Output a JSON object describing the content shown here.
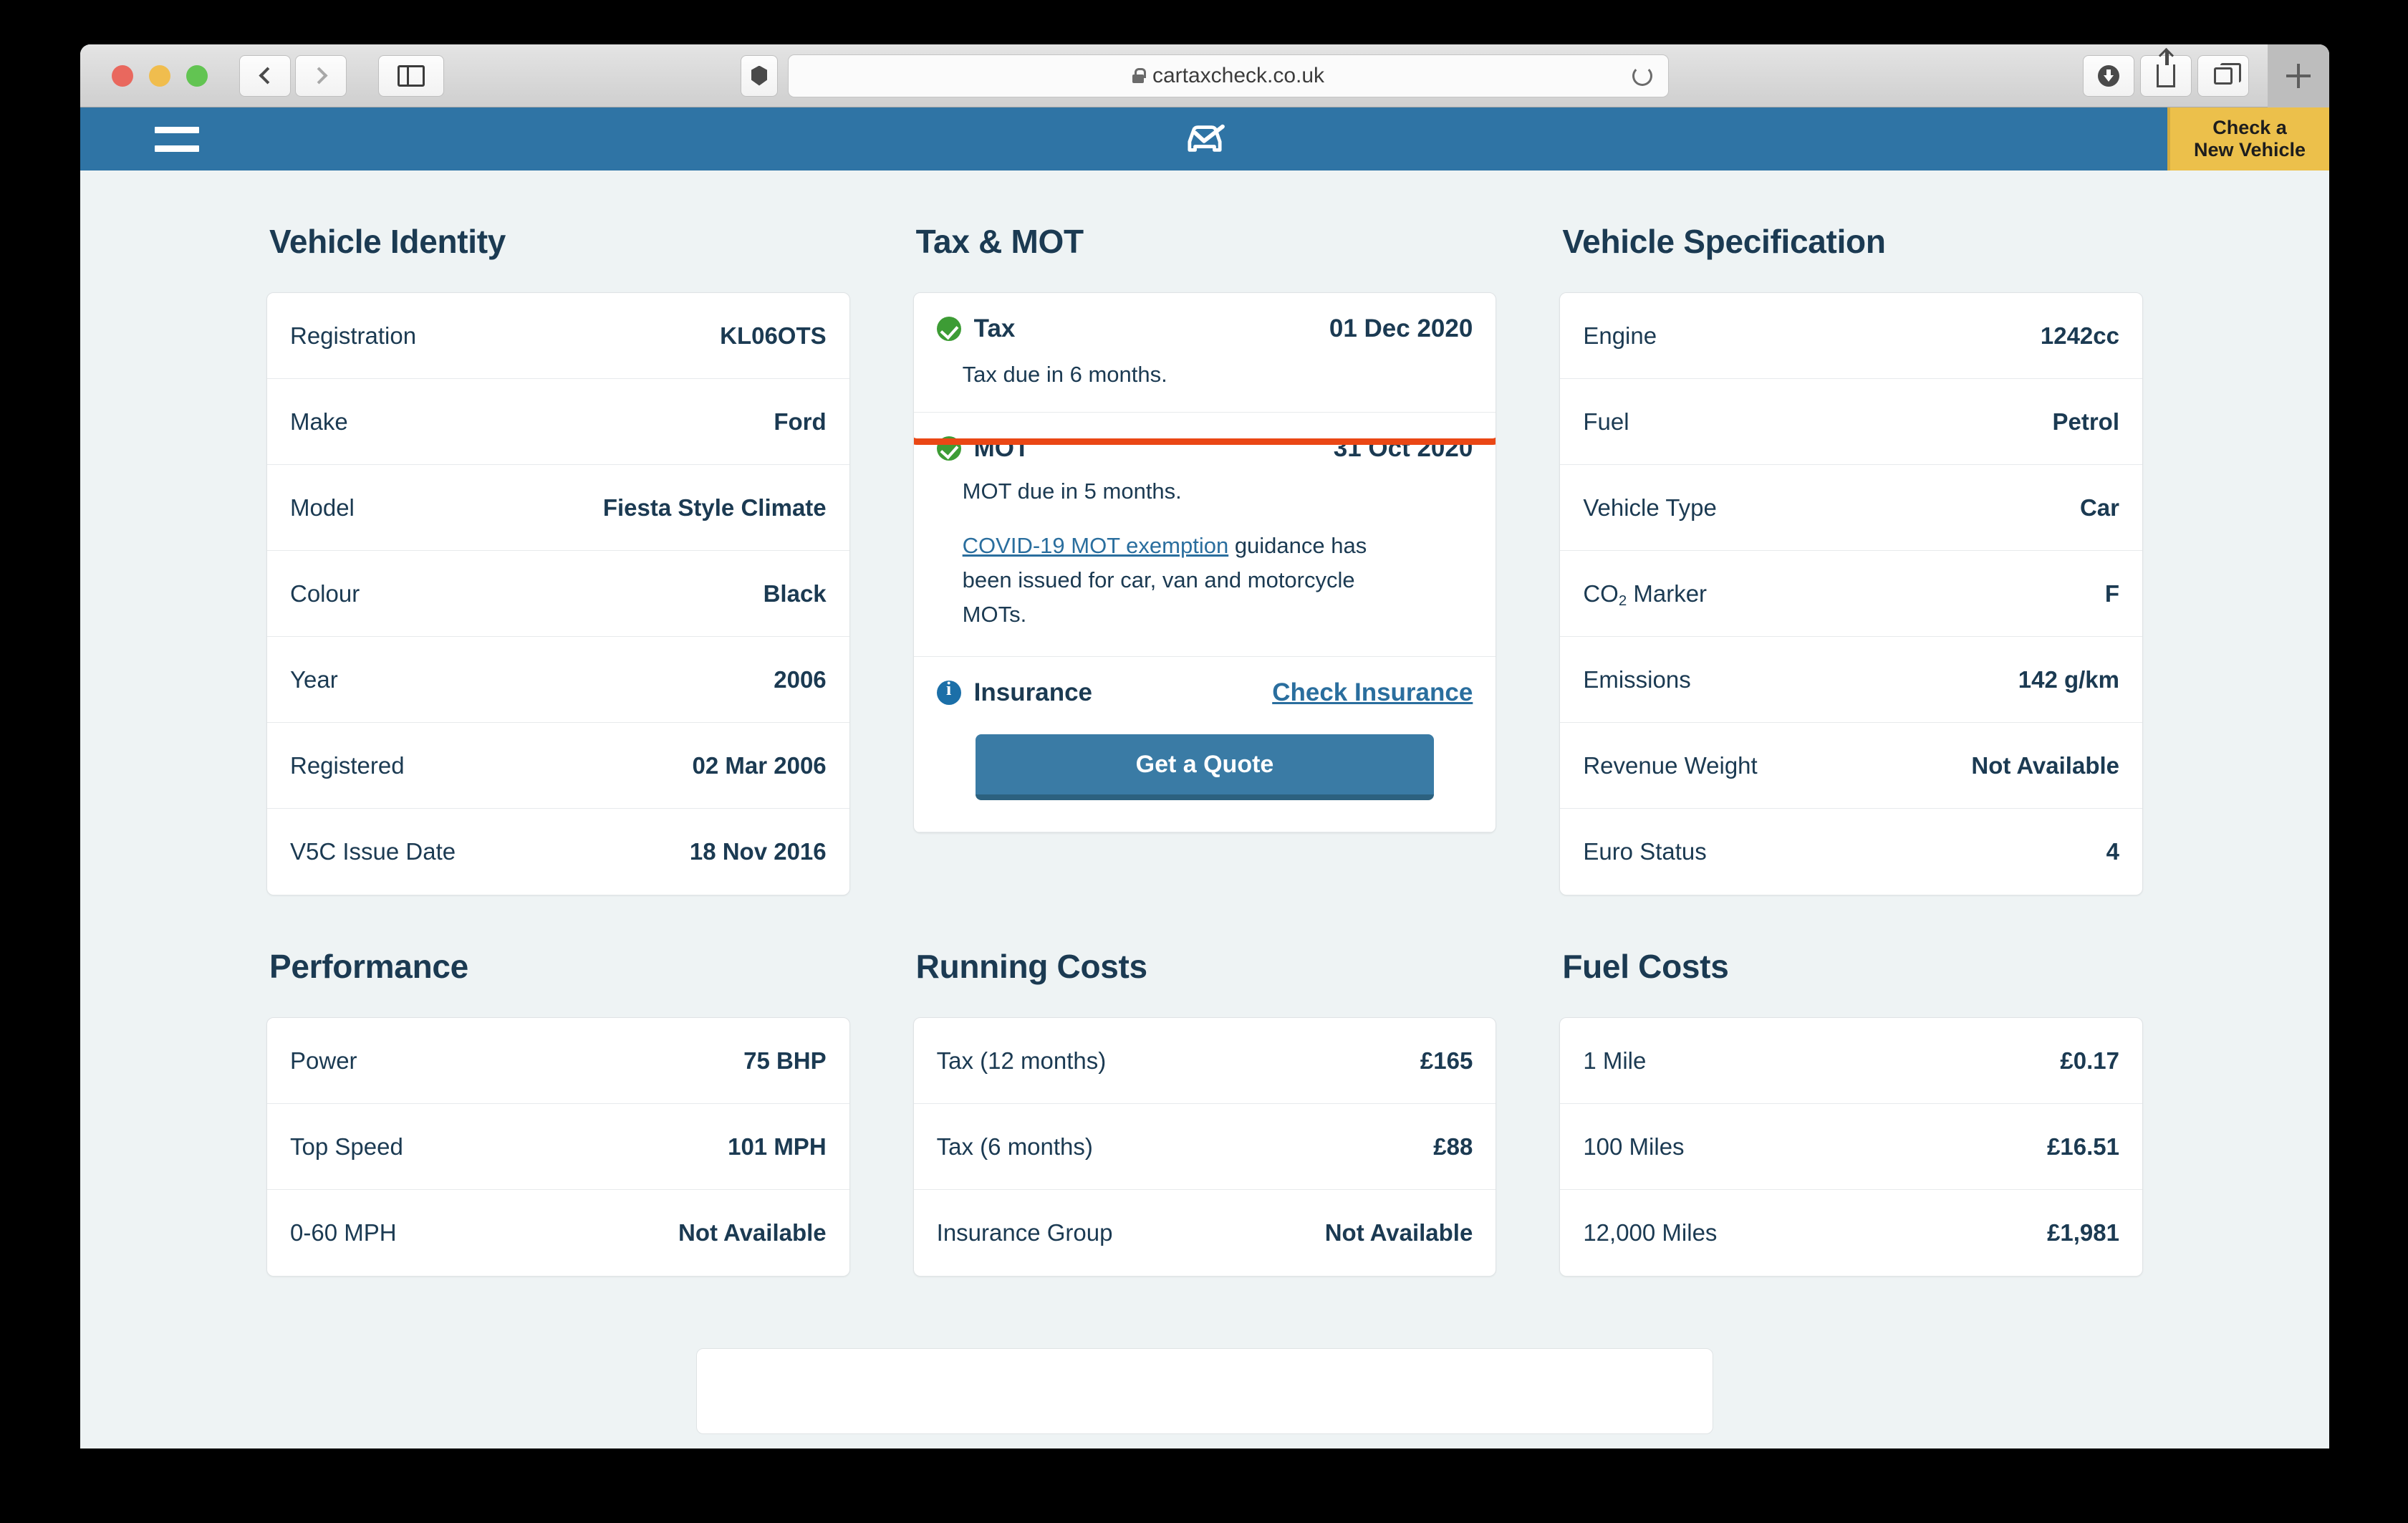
{
  "browser": {
    "url": "cartaxcheck.co.uk",
    "lock_icon": "lock-icon",
    "back_icon": "chevron-left-icon",
    "forward_icon": "chevron-right-icon",
    "sidebar_icon": "sidebar-icon",
    "shield_icon": "shield-icon",
    "reload_icon": "reload-icon",
    "downloads_icon": "downloads-icon",
    "share_icon": "share-icon",
    "tabs_icon": "tabs-overview-icon",
    "new_tab_icon": "plus-icon"
  },
  "site_header": {
    "menu_icon": "hamburger-menu-icon",
    "logo_icon": "car-check-logo-icon",
    "check_button_line1": "Check a",
    "check_button_line2": "New Vehicle"
  },
  "sections": {
    "vehicle_identity": {
      "title": "Vehicle Identity",
      "rows": [
        {
          "label": "Registration",
          "value": "KL06OTS"
        },
        {
          "label": "Make",
          "value": "Ford"
        },
        {
          "label": "Model",
          "value": "Fiesta Style Climate"
        },
        {
          "label": "Colour",
          "value": "Black"
        },
        {
          "label": "Year",
          "value": "2006"
        },
        {
          "label": "Registered",
          "value": "02 Mar 2006"
        },
        {
          "label": "V5C Issue Date",
          "value": "18 Nov 2016"
        }
      ]
    },
    "tax_mot": {
      "title": "Tax & MOT",
      "tax": {
        "label": "Tax",
        "date": "01 Dec 2020",
        "note": "Tax due in 6 months.",
        "status_icon": "green-check-icon"
      },
      "mot": {
        "label": "MOT",
        "date": "31 Oct 2020",
        "note": "MOT due in 5 months.",
        "covid_link": "COVID-19 MOT exemption",
        "covid_rest": " guidance has been issued for car, van and motorcycle MOTs.",
        "status_icon": "green-check-icon"
      },
      "insurance": {
        "label": "Insurance",
        "link": "Check Insurance",
        "button": "Get a Quote",
        "status_icon": "info-icon"
      }
    },
    "vehicle_specification": {
      "title": "Vehicle Specification",
      "rows": [
        {
          "label": "Engine",
          "value": "1242cc"
        },
        {
          "label": "Fuel",
          "value": "Petrol"
        },
        {
          "label": "Vehicle Type",
          "value": "Car"
        },
        {
          "label": "CO2 Marker",
          "value": "F"
        },
        {
          "label": "Emissions",
          "value": "142 g/km"
        },
        {
          "label": "Revenue Weight",
          "value": "Not Available"
        },
        {
          "label": "Euro Status",
          "value": "4"
        }
      ]
    },
    "performance": {
      "title": "Performance",
      "rows": [
        {
          "label": "Power",
          "value": "75 BHP"
        },
        {
          "label": "Top Speed",
          "value": "101 MPH"
        },
        {
          "label": "0-60 MPH",
          "value": "Not Available"
        }
      ]
    },
    "running_costs": {
      "title": "Running Costs",
      "rows": [
        {
          "label": "Tax (12 months)",
          "value": "£165"
        },
        {
          "label": "Tax (6 months)",
          "value": "£88"
        },
        {
          "label": "Insurance Group",
          "value": "Not Available"
        }
      ]
    },
    "fuel_costs": {
      "title": "Fuel Costs",
      "rows": [
        {
          "label": "1 Mile",
          "value": "£0.17"
        },
        {
          "label": "100 Miles",
          "value": "£16.51"
        },
        {
          "label": "12,000 Miles",
          "value": "£1,981"
        }
      ]
    }
  },
  "colors": {
    "header_blue": "#2f74a5",
    "accent_yellow": "#ecc04b",
    "text_navy": "#1b3a52",
    "highlight_orange": "#ea4715",
    "status_green": "#3d9c35",
    "link_blue": "#2a6e9e",
    "page_bg": "#eef3f4"
  }
}
